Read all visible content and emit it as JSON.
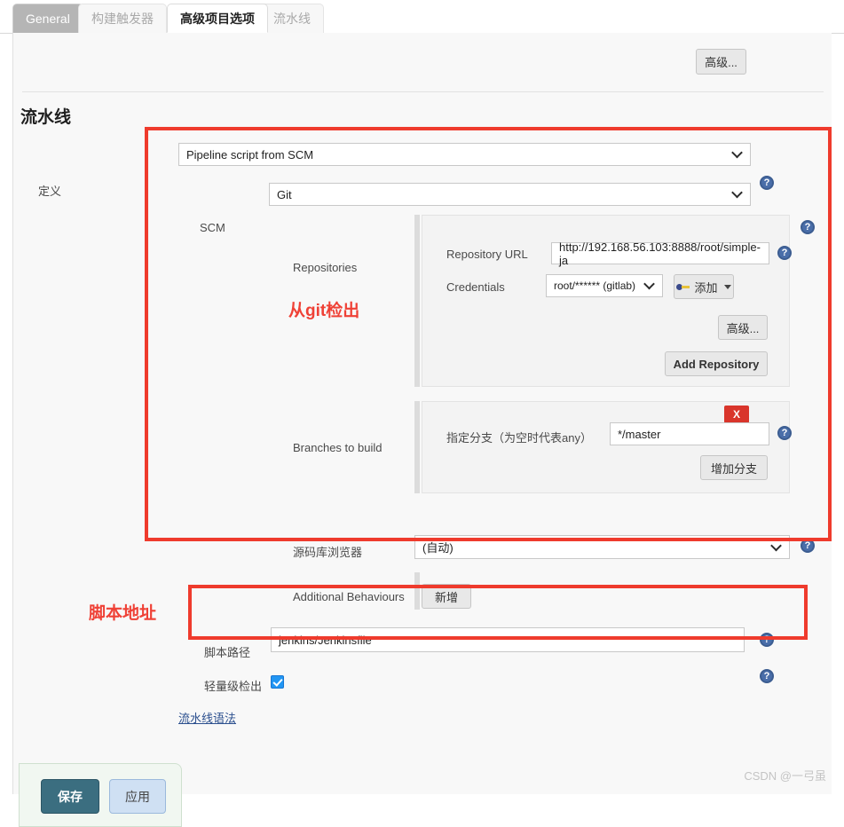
{
  "tabs": [
    {
      "label": "General",
      "state": "selected"
    },
    {
      "label": "构建触发器",
      "state": "normal"
    },
    {
      "label": "高级项目选项",
      "state": "active"
    },
    {
      "label": "流水线",
      "state": "normal"
    }
  ],
  "toolbar": {
    "advanced_label": "高级..."
  },
  "section": {
    "title": "流水线"
  },
  "definition": {
    "label": "定义",
    "value": "Pipeline script from SCM"
  },
  "scm": {
    "label": "SCM",
    "value": "Git"
  },
  "repositories": {
    "label": "Repositories",
    "url_label": "Repository URL",
    "url_value": "http://192.168.56.103:8888/root/simple-ja",
    "credentials_label": "Credentials",
    "credentials_value": "root/****** (gitlab)",
    "add_credentials_label": "添加",
    "advanced_label": "高级...",
    "add_repository_label": "Add Repository"
  },
  "branches": {
    "label": "Branches to build",
    "specifier_label": "指定分支（为空时代表any）",
    "specifier_value": "*/master",
    "add_branch_label": "增加分支",
    "delete_label": "X"
  },
  "browser": {
    "label": "源码库浏览器",
    "value": "(自动)"
  },
  "additional_behaviours": {
    "label": "Additional Behaviours",
    "add_label": "新增"
  },
  "script_path": {
    "label": "脚本路径",
    "value": "jenkins/Jenkinsfile"
  },
  "lightweight": {
    "label": "轻量级检出",
    "checked": true
  },
  "pipeline_syntax": {
    "label": "流水线语法"
  },
  "footer": {
    "save_label": "保存",
    "apply_label": "应用"
  },
  "annotations": {
    "git_checkout": "从git检出",
    "script_address": "脚本地址",
    "box_color": "#ef3b2d"
  },
  "watermark": {
    "text": "CSDN @一弓虽"
  },
  "icons": {
    "help": "?"
  }
}
